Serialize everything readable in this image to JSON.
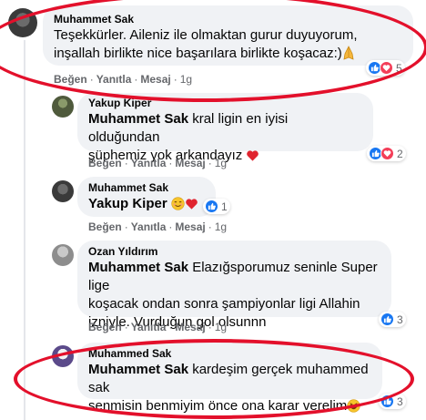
{
  "actions": {
    "like": "Beğen",
    "reply": "Yanıtla",
    "message": "Mesaj",
    "separator": "·"
  },
  "comments": [
    {
      "author": "Muhammet Sak",
      "line1": "Teşekkürler. Aileniz ile olmaktan gurur duyuyorum,",
      "line2": "inşallah birlikte nice başarılara birlikte koşacaz:)",
      "time": "1g",
      "reaction_count": "5",
      "reactions": [
        "like-icon",
        "love-icon"
      ]
    },
    {
      "author": "Yakup Kiper",
      "mention": "Muhammet Sak",
      "line1_rest": " kral ligin en iyisi olduğundan",
      "line2": "şüphemiz yok arkandayız",
      "time": "1g",
      "reaction_count": "2",
      "reactions": [
        "like-icon",
        "love-icon"
      ]
    },
    {
      "author": "Muhammet Sak",
      "mention": "Yakup Kiper",
      "time": "1g",
      "reaction_count": "1",
      "reactions": [
        "like-icon"
      ]
    },
    {
      "author": "Ozan Yıldırım",
      "mention": "Muhammet Sak",
      "line1_rest": " Elazığsporumuz seninle Super lige",
      "line2": "koşacak ondan sonra şampiyonlar ligi Allahin",
      "line3": "izniyle. Vurduğun gol olsunnn",
      "time": "1g",
      "reaction_count": "3",
      "reactions": [
        "like-icon"
      ]
    },
    {
      "author": "Muhammed Sak",
      "mention": "Muhammet Sak",
      "line1_rest": " kardeşim gerçek muhammed sak",
      "line2": "senmisin benmiyim önce ona karar verelim",
      "reaction_count": "3",
      "reactions": [
        "like-icon"
      ]
    }
  ],
  "colors": {
    "highlight_ring": "#e3102b",
    "bubble": "#f0f2f5",
    "like": "#1877f2",
    "love": "#f33e58"
  }
}
